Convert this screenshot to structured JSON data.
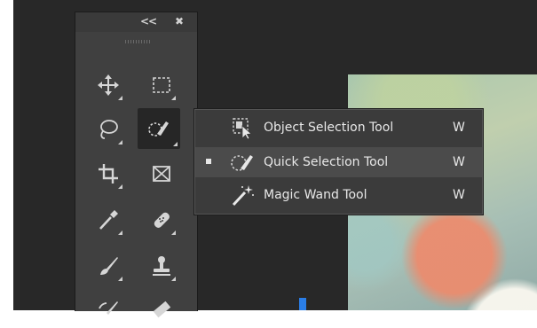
{
  "panel": {
    "collapse_glyph": "<<",
    "close_glyph": "✖",
    "tools": [
      {
        "name": "move-tool",
        "icon": "move-icon"
      },
      {
        "name": "rectangular-marquee-tool",
        "icon": "marquee-icon"
      },
      {
        "name": "lasso-tool",
        "icon": "lasso-icon"
      },
      {
        "name": "quick-selection-tool",
        "icon": "quick-selection-icon",
        "active": true
      },
      {
        "name": "crop-tool",
        "icon": "crop-icon"
      },
      {
        "name": "frame-tool",
        "icon": "frame-icon"
      },
      {
        "name": "eyedropper-tool",
        "icon": "eyedropper-icon"
      },
      {
        "name": "spot-healing-brush-tool",
        "icon": "bandage-icon"
      },
      {
        "name": "brush-tool",
        "icon": "brush-icon"
      },
      {
        "name": "clone-stamp-tool",
        "icon": "stamp-icon"
      },
      {
        "name": "history-brush-tool",
        "icon": "history-brush-icon"
      },
      {
        "name": "eraser-tool",
        "icon": "eraser-icon"
      }
    ]
  },
  "flyout": {
    "items": [
      {
        "label": "Object Selection Tool",
        "shortcut": "W",
        "icon": "object-selection-icon",
        "selected": false
      },
      {
        "label": "Quick Selection Tool",
        "shortcut": "W",
        "icon": "quick-selection-icon",
        "selected": true
      },
      {
        "label": "Magic Wand Tool",
        "shortcut": "W",
        "icon": "magic-wand-icon",
        "selected": false
      }
    ]
  },
  "colors": {
    "workspace_bg": "#282828",
    "panel_bg": "#404040",
    "flyout_bg": "#3b3b3b",
    "flyout_selected_bg": "#4b4b4b",
    "accent_blue": "#2a7ee8"
  }
}
